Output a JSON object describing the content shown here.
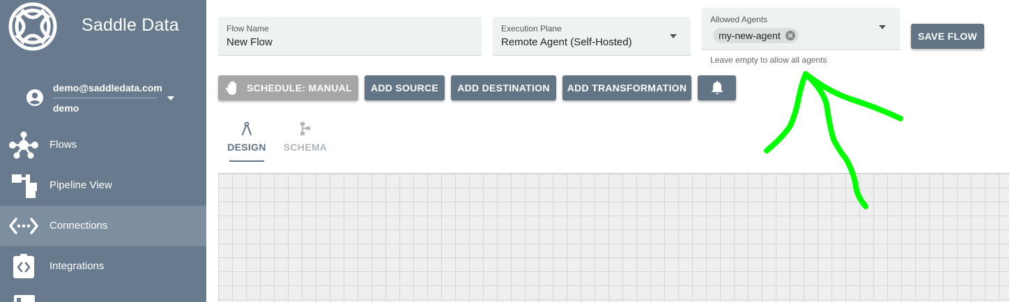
{
  "brand": {
    "name": "Saddle Data",
    "logo_icon": "celtic-knot-logo-icon"
  },
  "user": {
    "email": "demo@saddledata.com",
    "username": "demo"
  },
  "sidebar": {
    "items": [
      {
        "label": "Flows",
        "icon": "network-nodes-icon"
      },
      {
        "label": "Pipeline View",
        "icon": "pipeline-icon"
      },
      {
        "label": "Connections",
        "icon": "connection-icon",
        "active": true
      },
      {
        "label": "Integrations",
        "icon": "integration-icon"
      }
    ]
  },
  "form": {
    "flow_name": {
      "label": "Flow Name",
      "value": "New Flow"
    },
    "execution_plane": {
      "label": "Execution Plane",
      "value": "Remote Agent (Self-Hosted)"
    },
    "allowed_agents": {
      "label": "Allowed Agents",
      "chip": "my-new-agent",
      "helper": "Leave empty to allow all agents"
    }
  },
  "toolbar": {
    "save_flow": "SAVE FLOW",
    "schedule": "SCHEDULE: MANUAL",
    "add_source": "ADD SOURCE",
    "add_destination": "ADD DESTINATION",
    "add_transformation": "ADD TRANSFORMATION",
    "notifications_icon": "bell-icon"
  },
  "tabs": [
    {
      "label": "DESIGN",
      "icon": "compass-icon",
      "active": true
    },
    {
      "label": "SCHEMA",
      "icon": "schema-icon",
      "active": false
    }
  ],
  "colors": {
    "sidebar": "#687b8e",
    "sidebar_active": "#7d8f9f",
    "button": "#627587",
    "button_disabled": "#a6a6a6",
    "annotation": "#00ff00"
  }
}
